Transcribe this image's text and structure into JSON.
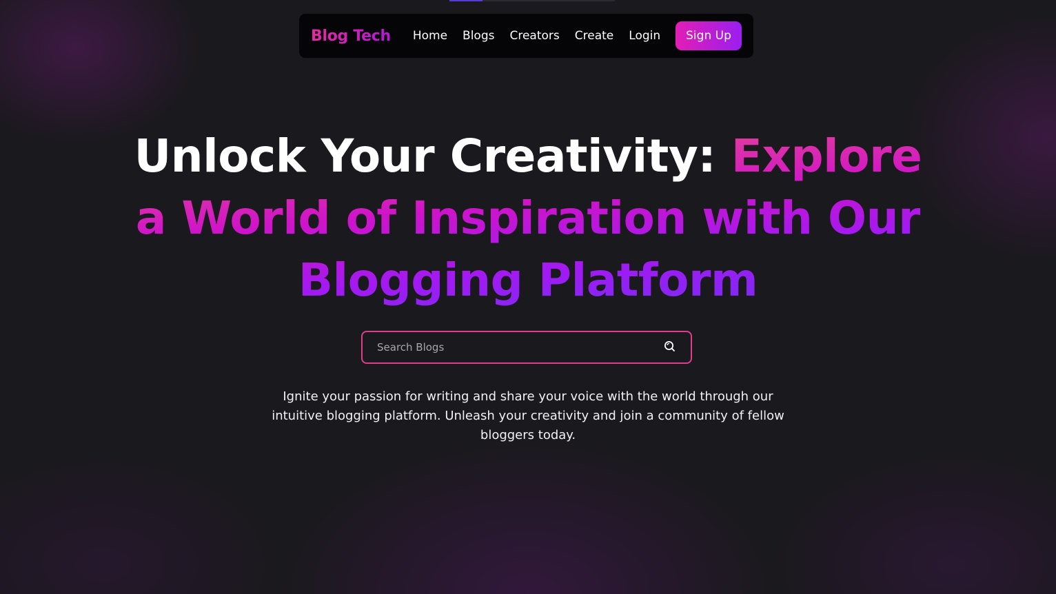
{
  "brand": {
    "name": "Blog Tech"
  },
  "nav": {
    "links": [
      {
        "label": "Home"
      },
      {
        "label": "Blogs"
      },
      {
        "label": "Creators"
      },
      {
        "label": "Create"
      },
      {
        "label": "Login"
      }
    ],
    "signup_label": "Sign Up"
  },
  "hero": {
    "title_plain": "Unlock Your Creativity:",
    "title_accent": "Explore a World of Inspiration with Our Blogging Platform",
    "description": "Ignite your passion for writing and share your voice with the world through our intuitive blogging platform. Unleash your creativity and join a community of fellow bloggers today."
  },
  "search": {
    "placeholder": "Search Blogs",
    "value": "",
    "icon": "search-icon"
  },
  "colors": {
    "background": "#1a191d",
    "navbar": "#050507",
    "brand_gradient_start": "#e62aa0",
    "brand_gradient_end": "#b518d6",
    "signup_gradient_start": "#e21eb4",
    "signup_gradient_end": "#9b1ef0",
    "search_border": "#e03e8c",
    "accent_pink": "#e33e9a",
    "accent_purple": "#a11af2"
  }
}
